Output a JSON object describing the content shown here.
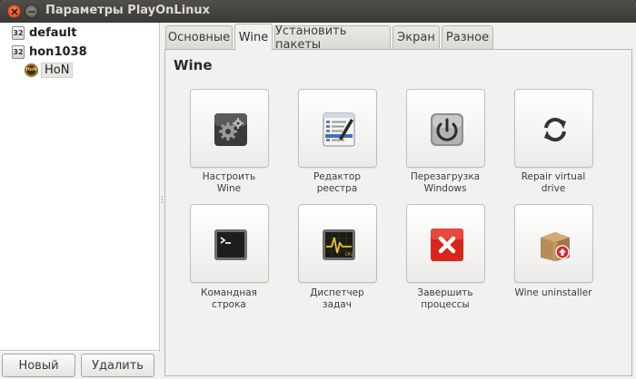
{
  "window": {
    "title": "Параметры PlayOnLinux"
  },
  "sidebar": {
    "items": [
      {
        "label": "default",
        "badge": "32"
      },
      {
        "label": "hon1038",
        "badge": "32"
      },
      {
        "label": "HoN",
        "icon": "hon-game-icon",
        "selected": true
      }
    ],
    "new_label": "Новый",
    "delete_label": "Удалить"
  },
  "tabs": [
    {
      "label": "Основные",
      "active": false
    },
    {
      "label": "Wine",
      "active": true
    },
    {
      "label": "Установить пакеты",
      "active": false
    },
    {
      "label": "Экран",
      "active": false
    },
    {
      "label": "Разное",
      "active": false
    }
  ],
  "panel": {
    "title": "Wine",
    "tools": [
      {
        "label": "Настроить\nWine",
        "icon": "configure-gear-icon"
      },
      {
        "label": "Редактор\nреестра",
        "icon": "registry-editor-icon"
      },
      {
        "label": "Перезагрузка\nWindows",
        "icon": "power-icon"
      },
      {
        "label": "Repair virtual\ndrive",
        "icon": "repair-refresh-icon"
      },
      {
        "label": "Командная\nстрока",
        "icon": "terminal-icon"
      },
      {
        "label": "Диспетчер\nзадач",
        "icon": "task-manager-icon"
      },
      {
        "label": "Завершить\nпроцессы",
        "icon": "kill-processes-icon"
      },
      {
        "label": "Wine uninstaller",
        "icon": "uninstaller-box-icon"
      }
    ]
  },
  "colors": {
    "titlebar": "#3c3b37",
    "close_button": "#e0471d",
    "window_bg": "#f2f1f0",
    "kill_red": "#d9261c"
  }
}
